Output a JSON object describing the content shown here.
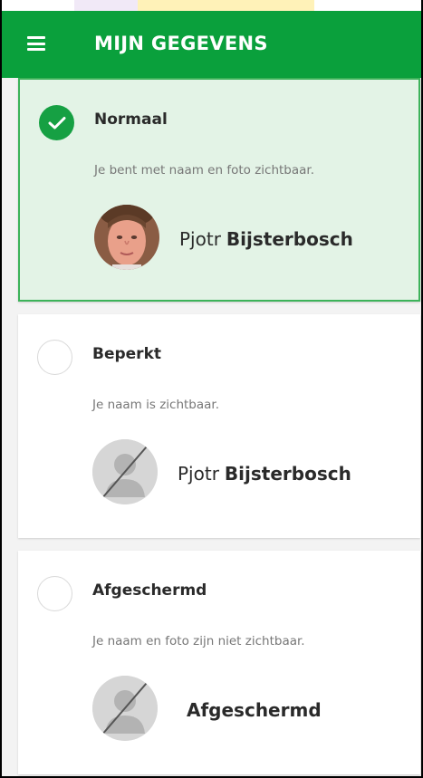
{
  "header": {
    "title": "MIJN GEGEVENS",
    "menu_icon": "hamburger-menu-icon",
    "background_color": "#0aa03c"
  },
  "options": [
    {
      "title": "Normaal",
      "description": "Je bent met naam en foto zichtbaar.",
      "selected": true,
      "display_first": "Pjotr",
      "display_last": "Bijsterbosch",
      "avatar": "photo"
    },
    {
      "title": "Beperkt",
      "description": "Je naam is zichtbaar.",
      "selected": false,
      "display_first": "Pjotr",
      "display_last": "Bijsterbosch",
      "avatar": "no-photo-icon"
    },
    {
      "title": "Afgeschermd",
      "description": "Je naam en foto zijn niet zichtbaar.",
      "selected": false,
      "display_name": "Afgeschermd",
      "avatar": "no-photo-icon"
    }
  ],
  "colors": {
    "selected_card_bg": "#e3f3e6",
    "selected_border": "#3db35a",
    "check_fill": "#16a043"
  }
}
